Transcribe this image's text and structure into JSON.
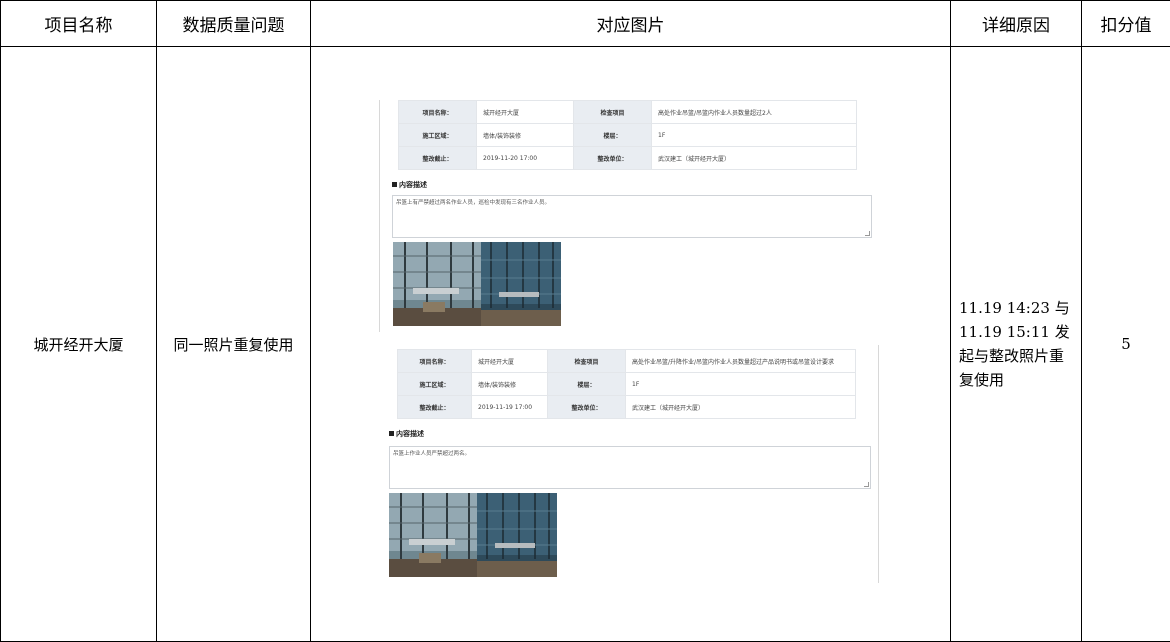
{
  "table": {
    "headers": [
      "项目名称",
      "数据质量问题",
      "对应图片",
      "详细原因",
      "扣分值"
    ],
    "row": {
      "project": "城开经开大厦",
      "issue": "同一照片重复使用",
      "reason_lines": [
        "11.19 14:23 与",
        "11.19 15:11 发",
        "起与整改照片重",
        "复使用"
      ],
      "score": "5"
    }
  },
  "record1": {
    "labels": [
      "项目名称：",
      "检查项目",
      "施工区域：",
      "楼层：",
      "整改截止：",
      "整改单位："
    ],
    "values": [
      "城开经开大厦",
      "高处作业吊篮/吊篮内作业人员数量超过2人",
      "墙体/装饰装修",
      "1F",
      "2019-11-20 17:00",
      "武汉建工（城开经开大厦）"
    ],
    "section_title": "内容描述",
    "description": "吊篮上有严禁超过两名作业人员，巡检中发现有三名作业人员。"
  },
  "record2": {
    "labels": [
      "项目名称：",
      "检查项目",
      "施工区域：",
      "楼层：",
      "整改截止：",
      "整改单位："
    ],
    "values": [
      "城开经开大厦",
      "高处作业吊篮/升降作业/吊篮内作业人员数量超过产品说明书或吊篮设计要求",
      "墙体/装饰装修",
      "1F",
      "2019-11-19 17:00",
      "武汉建工（城开经开大厦）"
    ],
    "section_title": "内容描述",
    "description": "吊篮上作业人员严禁超过两名。"
  },
  "colors": {
    "border": "#000000",
    "label_bg": "#e9edf2"
  }
}
